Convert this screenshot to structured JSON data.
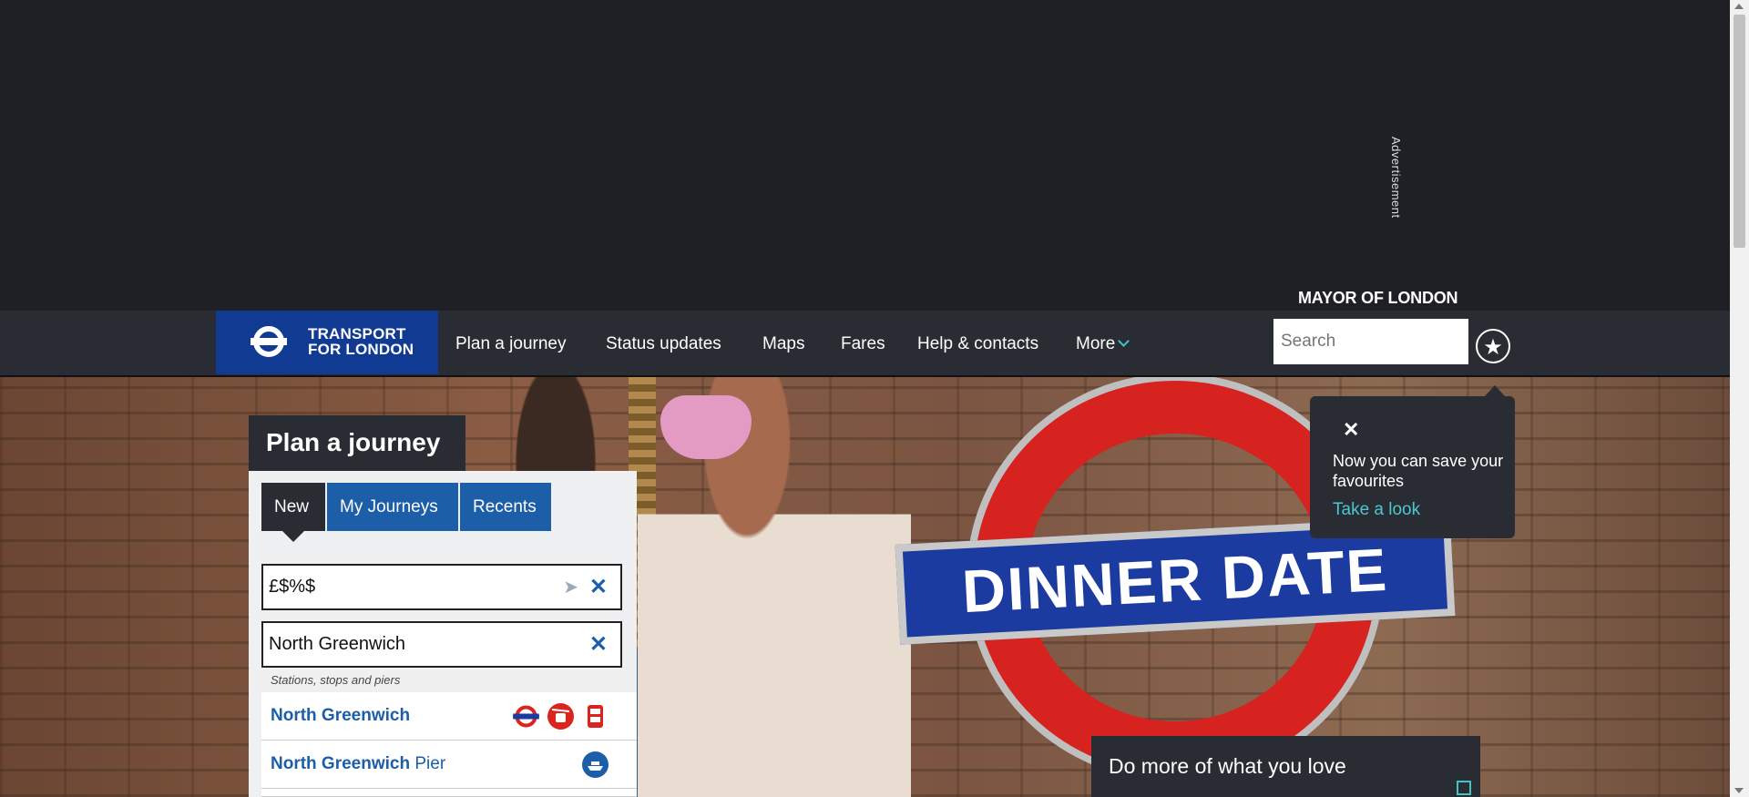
{
  "advert": {
    "label": "Advertisement"
  },
  "header": {
    "mayor": "MAYOR OF LONDON",
    "logo_line1": "TRANSPORT",
    "logo_line2": "FOR LONDON",
    "nav": [
      "Plan a journey",
      "Status updates",
      "Maps",
      "Fares",
      "Help & contacts",
      "More"
    ],
    "search_placeholder": "Search"
  },
  "hero": {
    "sign_text": "DINNER DATE",
    "promo": "Do more of what you love"
  },
  "tooltip": {
    "close": "✕",
    "message": "Now you can save your favourites",
    "link": "Take a look"
  },
  "planner": {
    "title": "Plan a journey",
    "tabs": [
      "New",
      "My Journeys",
      "Recents"
    ],
    "from_value": "£$%$",
    "to_value": "North Greenwich",
    "suggestions_heading": "Stations, stops and piers",
    "suggestions": [
      {
        "name": "North Greenwich",
        "suffix": "",
        "modes": [
          "tube-icon",
          "cable-car-icon",
          "bus-icon"
        ]
      },
      {
        "name": "North Greenwich",
        "suffix": " Pier",
        "modes": [
          "river-boat-icon"
        ]
      }
    ]
  },
  "colors": {
    "accent": "#113b92",
    "link": "#1c5ea8",
    "teal": "#4cc7d1",
    "dark": "#2a2c34"
  }
}
